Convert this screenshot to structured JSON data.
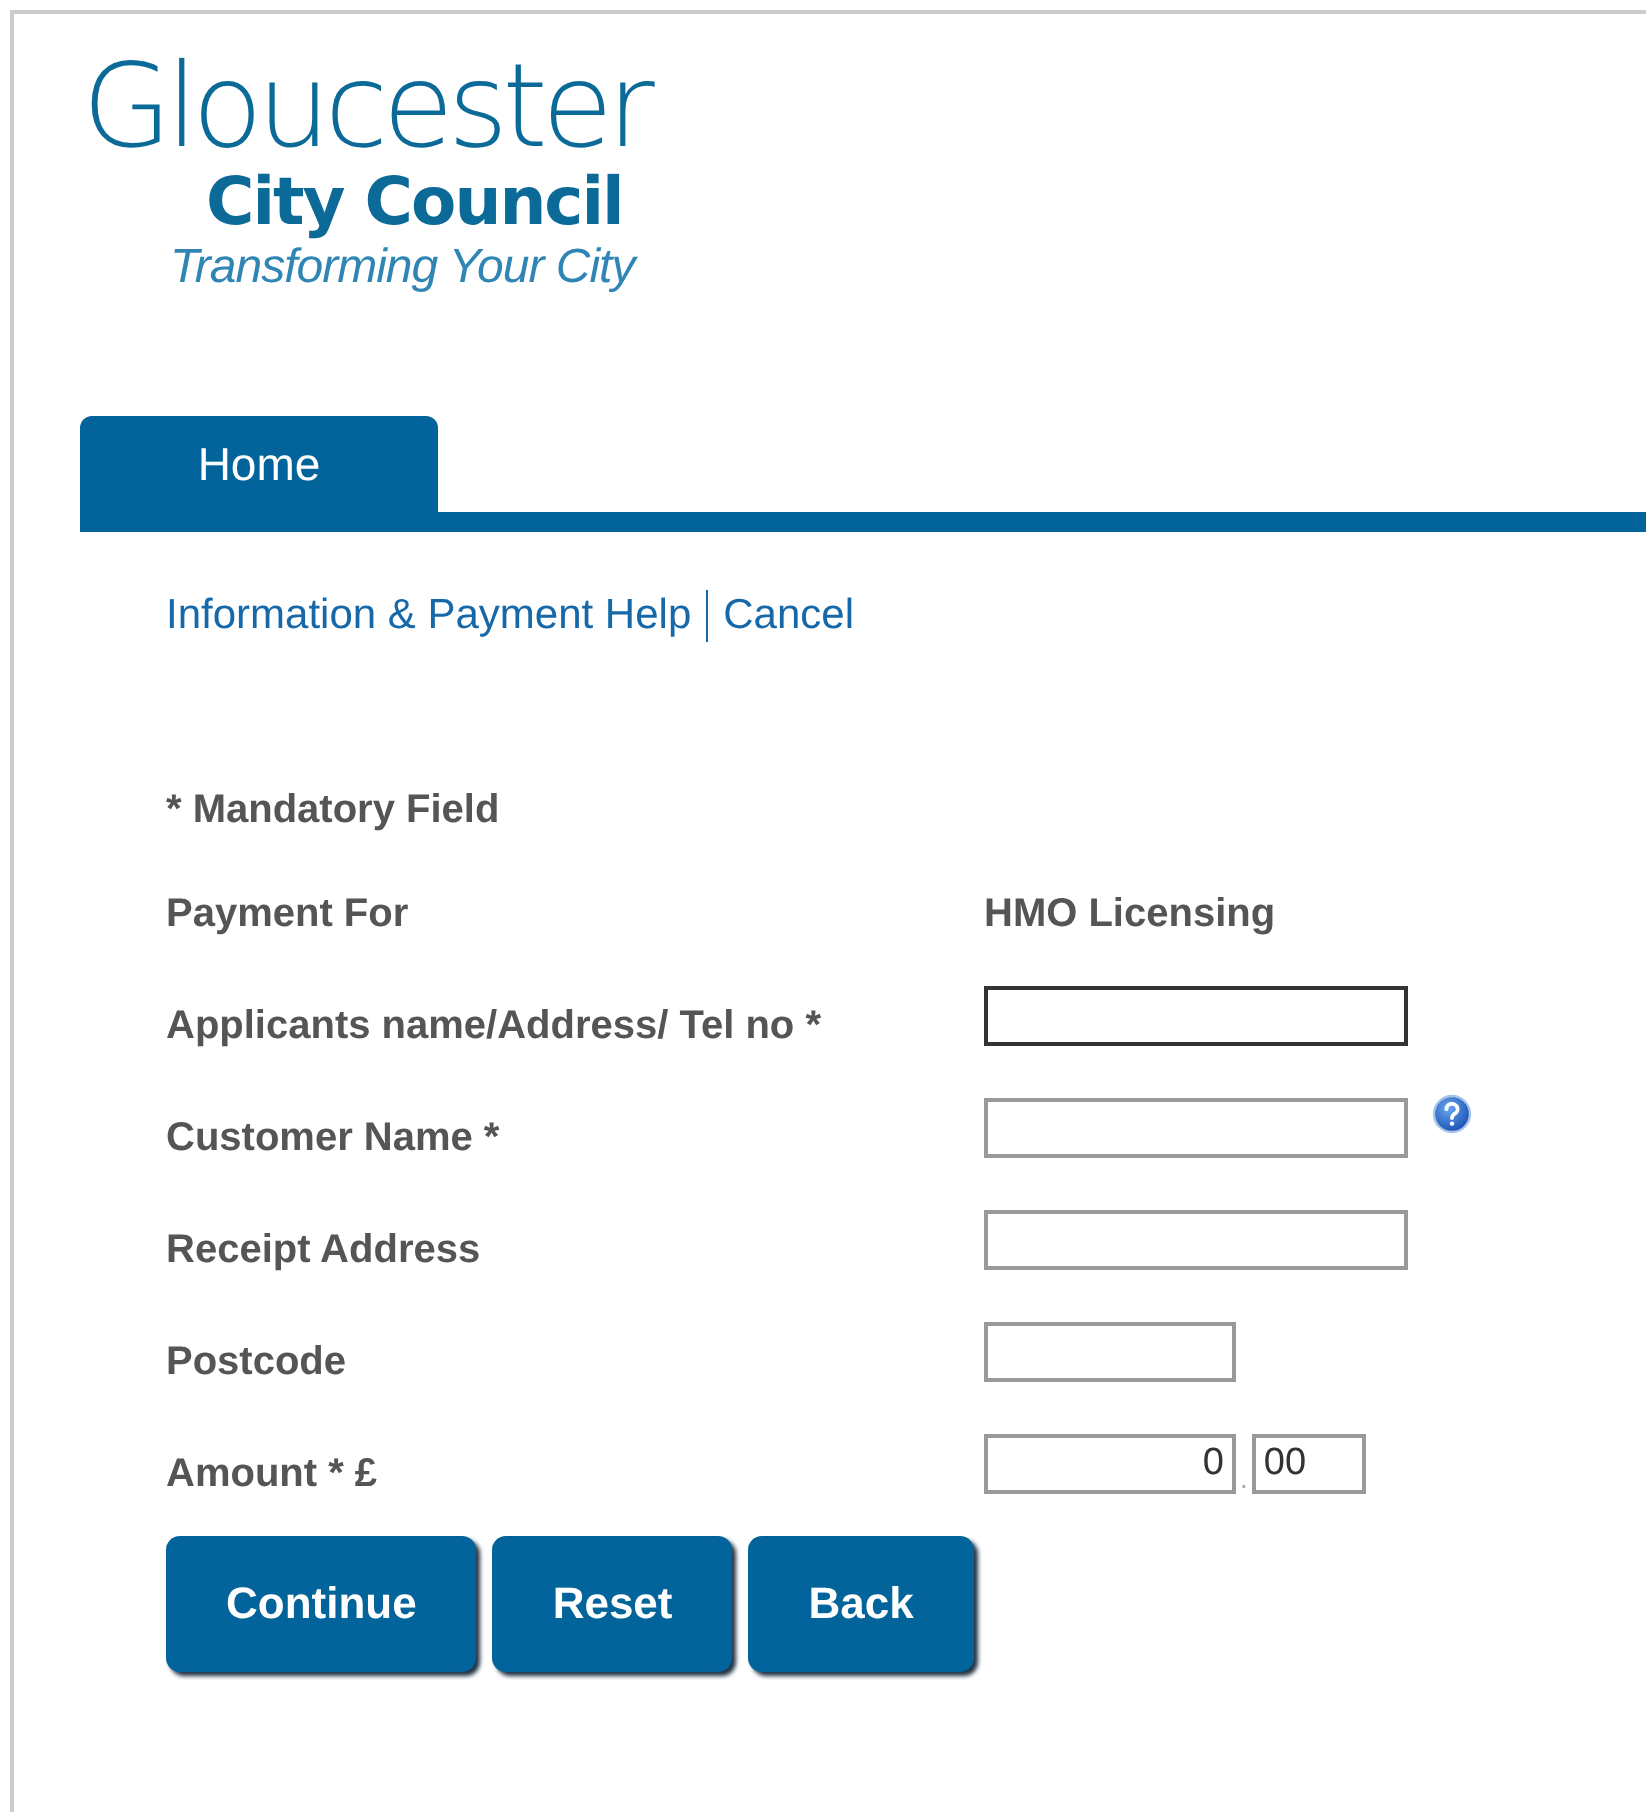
{
  "logo": {
    "name": "Gloucester",
    "subtitle": "City Council",
    "tagline": "Transforming Your City"
  },
  "tabs": [
    {
      "label": "Home",
      "selected": true
    }
  ],
  "links": [
    "Information & Payment Help",
    "Cancel"
  ],
  "mandatory_note": "* Mandatory Field",
  "fields": [
    {
      "label": "Payment For",
      "kind": "text",
      "value": "HMO Licensing"
    },
    {
      "label": "Applicants name/Address/ Tel no *",
      "kind": "input",
      "focused": true
    },
    {
      "label": "Customer Name *",
      "kind": "input",
      "help": true
    },
    {
      "label": "Receipt Address",
      "kind": "input"
    },
    {
      "label": "Postcode",
      "kind": "short_input"
    },
    {
      "label": "Amount * £",
      "kind": "amount",
      "pounds": "0",
      "separator": ".",
      "pence": "00"
    }
  ],
  "buttons": [
    "Continue",
    "Reset",
    "Back"
  ]
}
